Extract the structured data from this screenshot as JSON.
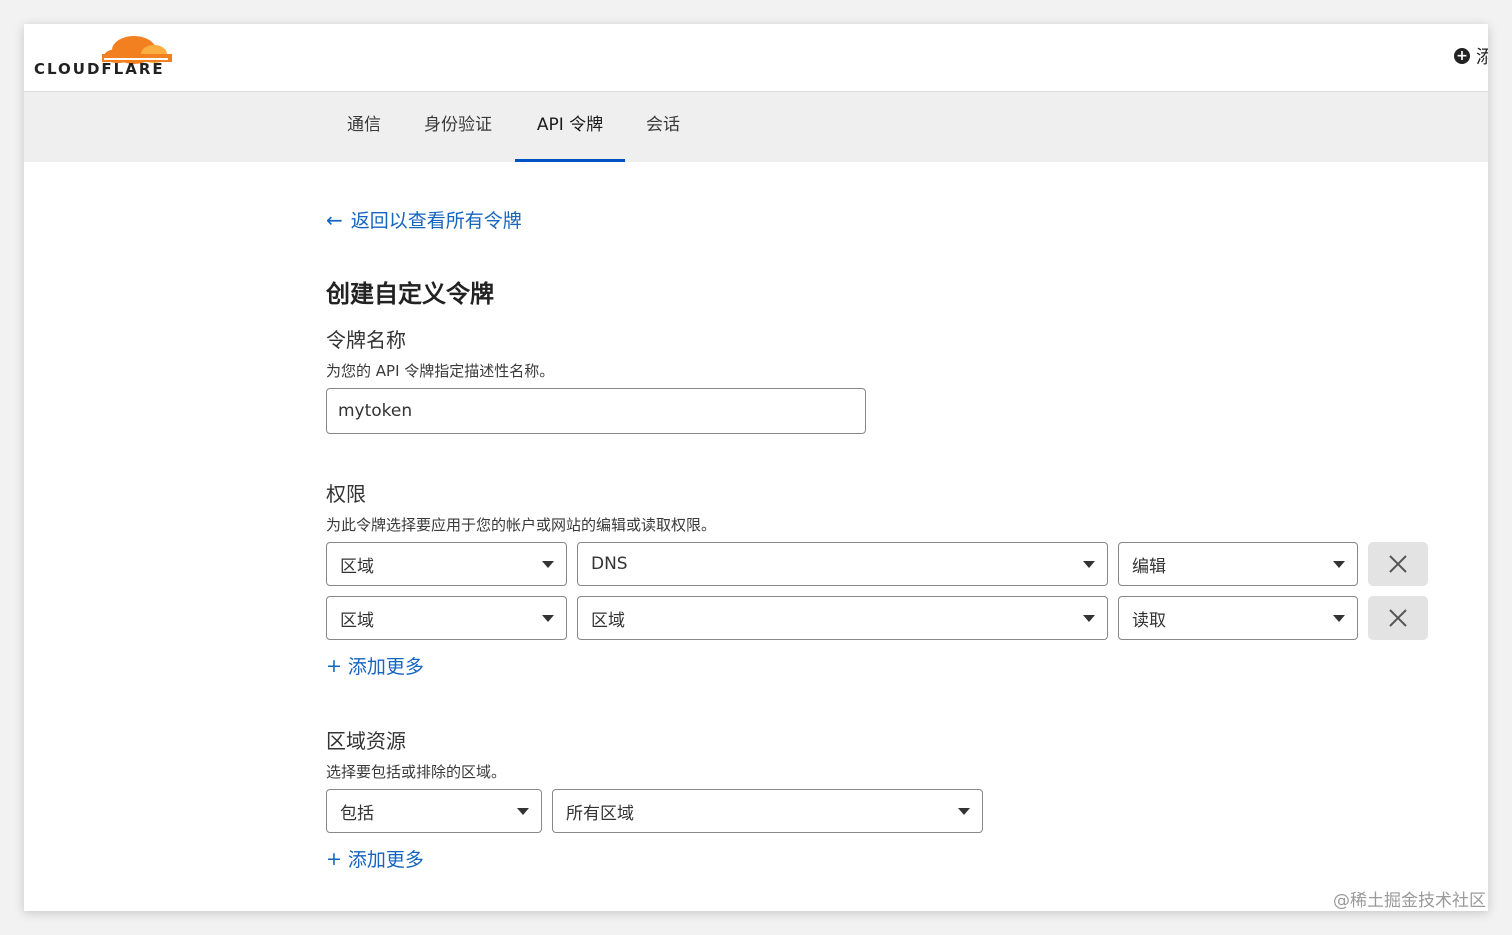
{
  "brand": {
    "logo_text": "CLOUDFLARE",
    "accent_orange": "#f38020",
    "accent_blue": "#0051c3"
  },
  "header": {
    "add_site_label": "添"
  },
  "tabs": [
    {
      "label": "通信"
    },
    {
      "label": "身份验证"
    },
    {
      "label": "API 令牌",
      "active": true
    },
    {
      "label": "会话"
    }
  ],
  "back_link": "返回以查看所有令牌",
  "page_title": "创建自定义令牌",
  "token_name": {
    "title": "令牌名称",
    "description": "为您的 API 令牌指定描述性名称。",
    "value": "mytoken"
  },
  "permissions": {
    "title": "权限",
    "description": "为此令牌选择要应用于您的帐户或网站的编辑或读取权限。",
    "rows": [
      {
        "scope": "区域",
        "resource": "DNS",
        "access": "编辑"
      },
      {
        "scope": "区域",
        "resource": "区域",
        "access": "读取"
      }
    ],
    "add_more": "添加更多"
  },
  "zone_resources": {
    "title": "区域资源",
    "description": "选择要包括或排除的区域。",
    "mode": "包括",
    "target": "所有区域",
    "add_more": "添加更多"
  },
  "watermark": "@稀土掘金技术社区"
}
